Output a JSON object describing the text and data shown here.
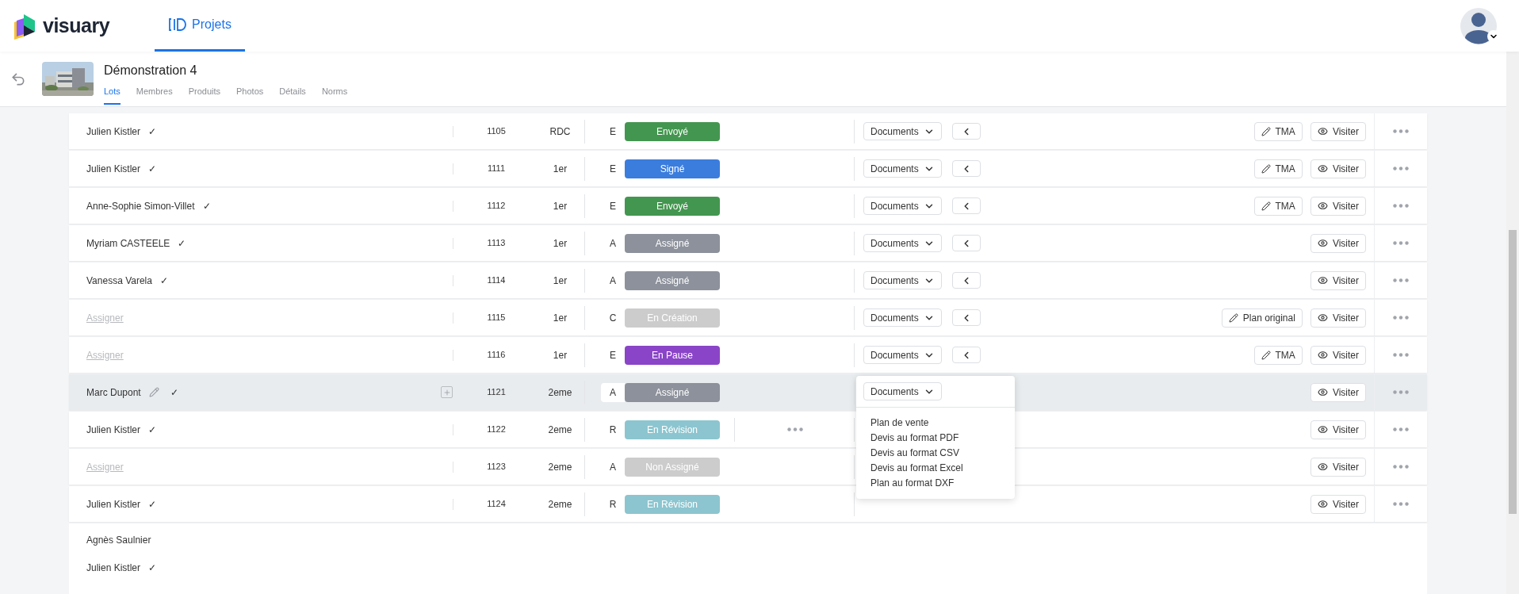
{
  "header": {
    "logo_text": "visuary",
    "nav": [
      {
        "label": "Projets",
        "selected": true
      }
    ]
  },
  "project": {
    "title": "Démonstration 4",
    "tabs": [
      {
        "label": "Lots",
        "selected": true
      },
      {
        "label": "Membres",
        "selected": false
      },
      {
        "label": "Produits",
        "selected": false
      },
      {
        "label": "Photos",
        "selected": false
      },
      {
        "label": "Détails",
        "selected": false
      },
      {
        "label": "Norms",
        "selected": false
      }
    ]
  },
  "rows": [
    {
      "name": "Julien Kistler",
      "assigned": true,
      "check": "✓",
      "lot": "1105",
      "floor": "RDC",
      "letter": "E",
      "status": "Envoyé",
      "color": "#43964f",
      "documents": "Documents",
      "edit_label": "TMA",
      "visit": "Visiter",
      "selected": false
    },
    {
      "name": "Julien Kistler",
      "assigned": true,
      "check": "✓",
      "lot": "1111",
      "floor": "1er",
      "letter": "E",
      "status": "Signé",
      "color": "#3b7ddd",
      "documents": "Documents",
      "edit_label": "TMA",
      "visit": "Visiter",
      "selected": false
    },
    {
      "name": "Anne-Sophie Simon-Villet",
      "assigned": true,
      "check": "✓",
      "lot": "1112",
      "floor": "1er",
      "letter": "E",
      "status": "Envoyé",
      "color": "#43964f",
      "documents": "Documents",
      "edit_label": "TMA",
      "visit": "Visiter",
      "selected": false
    },
    {
      "name": "Myriam CASTEELE",
      "assigned": true,
      "check": "✓",
      "lot": "1113",
      "floor": "1er",
      "letter": "A",
      "status": "Assigné",
      "color": "#8c919b",
      "documents": "Documents",
      "visit": "Visiter",
      "selected": false
    },
    {
      "name": "Vanessa Varela",
      "assigned": true,
      "check": "✓",
      "lot": "1114",
      "floor": "1er",
      "letter": "A",
      "status": "Assigné",
      "color": "#8c919b",
      "documents": "Documents",
      "visit": "Visiter",
      "selected": false
    },
    {
      "name": "Assigner",
      "assigned": false,
      "lot": "1115",
      "floor": "1er",
      "letter": "C",
      "status": "En Création",
      "color": "#cccccc",
      "documents": "Documents",
      "edit_label": "Plan original",
      "visit": "Visiter",
      "selected": false
    },
    {
      "name": "Assigner",
      "assigned": false,
      "lot": "1116",
      "floor": "1er",
      "letter": "E",
      "status": "En Pause",
      "color": "#8a44c8",
      "documents": "Documents",
      "edit_label": "TMA",
      "visit": "Visiter",
      "selected": false
    },
    {
      "name": "Marc Dupont",
      "assigned": true,
      "check": "✓",
      "lot": "1121",
      "floor": "2eme",
      "letter": "A",
      "status": "Assigné",
      "color": "#8c919b",
      "visit": "Visiter",
      "selected": true,
      "dropdown": {
        "button": "Documents",
        "items": [
          "Plan de vente",
          "Devis au format PDF",
          "Devis au format CSV",
          "Devis au format Excel",
          "Plan au format DXF"
        ]
      }
    },
    {
      "name": "Julien Kistler",
      "assigned": true,
      "check": "✓",
      "lot": "1122",
      "floor": "2eme",
      "letter": "R",
      "status": "En Révision",
      "color": "#8cc5cf",
      "visit": "Visiter",
      "selected": false,
      "extra_menu": true
    },
    {
      "name": "Assigner",
      "assigned": false,
      "lot": "1123",
      "floor": "2eme",
      "letter": "A",
      "status": "Non Assigné",
      "color": "#cccccc",
      "visit": "Visiter",
      "selected": false
    },
    {
      "name": "Julien Kistler",
      "assigned": true,
      "check": "✓",
      "lot": "1124",
      "floor": "2eme",
      "letter": "R",
      "status": "En Révision",
      "color": "#8cc5cf",
      "visit": "Visiter",
      "selected": false
    }
  ],
  "more_names": [
    {
      "name": "Agnès Saulnier"
    },
    {
      "name": "Julien Kistler",
      "check": "✓"
    }
  ]
}
